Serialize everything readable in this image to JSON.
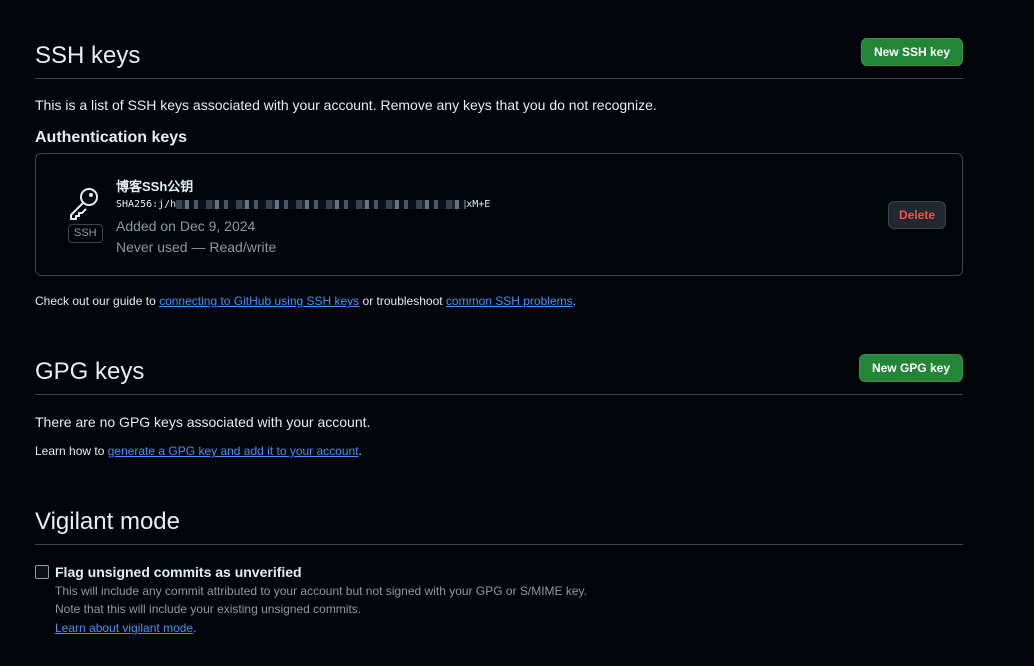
{
  "ssh": {
    "title": "SSH keys",
    "new_button": "New SSH key",
    "description": "This is a list of SSH keys associated with your account. Remove any keys that you do not recognize.",
    "subheading": "Authentication keys",
    "key": {
      "name": "博客SSh公钥",
      "fingerprint_prefix": "SHA256:j/h",
      "fingerprint_suffix": "xM+E",
      "added": "Added on Dec 9, 2024",
      "usage": "Never used — Read/write",
      "badge": "SSH",
      "delete_label": "Delete"
    },
    "guide": {
      "prefix": "Check out our guide to ",
      "link1": "connecting to GitHub using SSH keys",
      "middle": " or troubleshoot ",
      "link2": "common SSH problems",
      "suffix": "."
    }
  },
  "gpg": {
    "title": "GPG keys",
    "new_button": "New GPG key",
    "empty": "There are no GPG keys associated with your account.",
    "learn": {
      "prefix": "Learn how to ",
      "link": "generate a GPG key and add it to your account",
      "suffix": "."
    }
  },
  "vigilant": {
    "title": "Vigilant mode",
    "checkbox_label": "Flag unsigned commits as unverified",
    "checked": false,
    "note1": "This will include any commit attributed to your account but not signed with your GPG or S/MIME key.",
    "note2": "Note that this will include your existing unsigned commits.",
    "link": "Learn about vigilant mode",
    "link_suffix": "."
  },
  "colors": {
    "background": "#010409",
    "primary_button": "#238636",
    "link": "#4493f8",
    "danger": "#f85149",
    "border": "#3d444d",
    "muted": "#9198a1"
  },
  "icons": {
    "key": "key-icon"
  }
}
